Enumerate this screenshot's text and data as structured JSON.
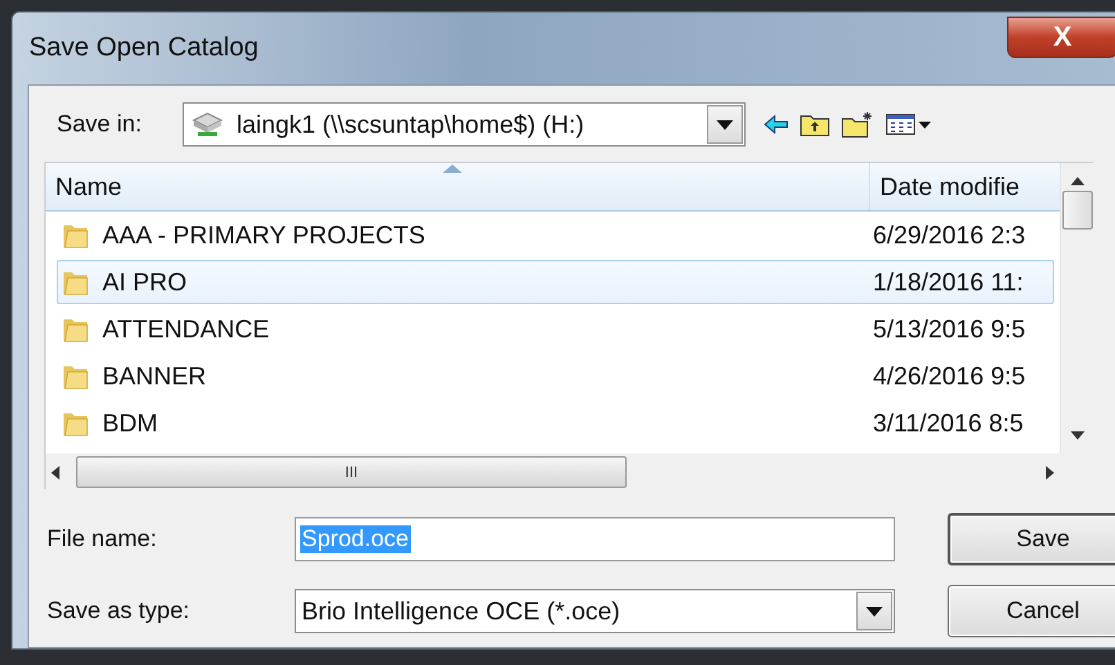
{
  "window": {
    "title": "Save Open Catalog",
    "close": "X"
  },
  "save_in": {
    "label": "Save in:",
    "value": "laingk1 (\\\\scsuntap\\home$) (H:)"
  },
  "file_list": {
    "columns": [
      "Name",
      "Date modifie"
    ],
    "rows": [
      {
        "name": "AAA - PRIMARY PROJECTS",
        "date": "6/29/2016 2:3",
        "selected": false
      },
      {
        "name": "AI PRO",
        "date": "1/18/2016 11:",
        "selected": true
      },
      {
        "name": "ATTENDANCE",
        "date": "5/13/2016 9:5",
        "selected": false
      },
      {
        "name": "BANNER",
        "date": "4/26/2016 9:5",
        "selected": false
      },
      {
        "name": "BDM",
        "date": "3/11/2016 8:5",
        "selected": false
      }
    ],
    "hscroll_grip": "III"
  },
  "file_name": {
    "label": "File name:",
    "value": "Sprod.oce"
  },
  "save_as_type": {
    "label": "Save as type:",
    "value": "Brio Intelligence OCE (*.oce)"
  },
  "buttons": [
    "Save",
    "Cancel"
  ]
}
